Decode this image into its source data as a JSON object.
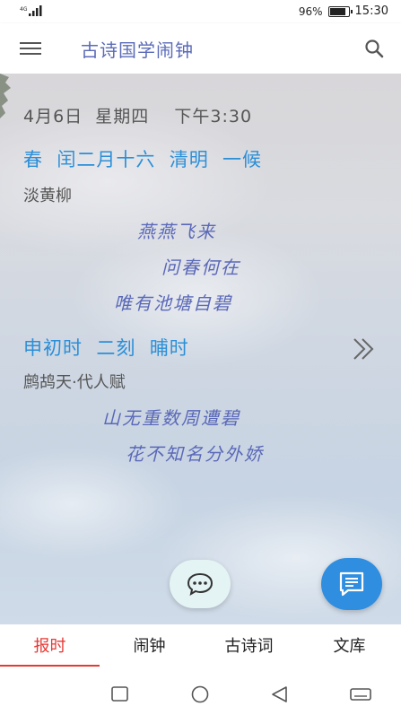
{
  "status_bar": {
    "network": "4G",
    "battery": "96%",
    "time": "15:30"
  },
  "app_bar": {
    "title": "古诗国学闹钟",
    "menu_icon": "menu-icon",
    "search_icon": "search-icon"
  },
  "report": {
    "date_line": "4月6日  星期四    下午3:30",
    "season_line": "春  闰二月十六  清明  一候",
    "poem1_title": "淡黄柳",
    "poem1_lines": [
      "燕燕飞来",
      "问春何在",
      "唯有池塘自碧"
    ],
    "hour_line": "申初时  二刻  晡时",
    "poem2_title": "鹧鸪天·代人赋",
    "poem2_lines": [
      "山无重数周遭碧",
      "花不知名分外娇"
    ]
  },
  "tabs": [
    {
      "label": "报时",
      "active": true
    },
    {
      "label": "闹钟",
      "active": false
    },
    {
      "label": "古诗词",
      "active": false
    },
    {
      "label": "文库",
      "active": false
    }
  ],
  "colors": {
    "accent_blue": "#2b8fd8",
    "poem_purple": "#5a68b8",
    "tab_active": "#e53935",
    "fab_blue": "#2f8ee0"
  }
}
